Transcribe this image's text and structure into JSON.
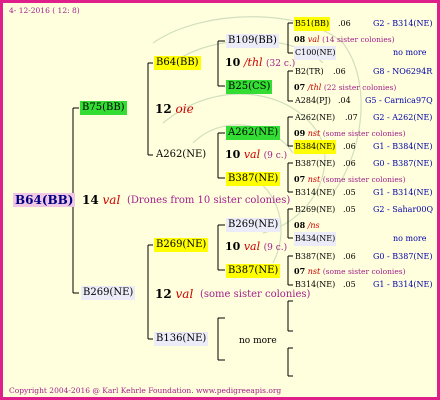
{
  "header": {
    "date": "4- 12-2016 ( 12:  8)"
  },
  "footer": {
    "text": "Copyright 2004-2016 @ Karl Kehrle Foundation.   www.pedigreeapis.org"
  },
  "root": {
    "name": "B64(BB)",
    "num": "14",
    "desc": "val",
    "note": "(Drones from 10 sister colonies)"
  },
  "gen1": {
    "top": {
      "name": "B75(BB)",
      "num": "12",
      "desc": "oie"
    },
    "bottom": {
      "name": "B269(NE)",
      "num": "12",
      "desc": "val",
      "note": "(some sister colonies)"
    }
  },
  "gen2": {
    "b64": {
      "name": "B64(BB)"
    },
    "a262": {
      "name": "A262(NE)"
    },
    "b269": {
      "name": "B269(NE)"
    },
    "b136": {
      "name": "B136(NE)",
      "note": "no more"
    }
  },
  "gen3": {
    "b109": {
      "name": "B109(BB)",
      "num": "10",
      "desc": "/thl",
      "note": "(32 c.)"
    },
    "b25": {
      "name": "B25(CS)"
    },
    "a262b": {
      "name": "A262(NE)",
      "num": "10",
      "desc": "val",
      "note": "(9 c.)"
    },
    "b387a": {
      "name": "B387(NE)"
    },
    "b269b": {
      "name": "B269(NE)",
      "num": "10",
      "desc": "val",
      "note": "(9 c.)"
    },
    "b387b": {
      "name": "B387(NE)"
    }
  },
  "gen4": {
    "g1": {
      "a": {
        "name": "B51(BB)",
        "score": ".06",
        "ref": "G2 - B314(NE)"
      },
      "num": "08",
      "desc": "val",
      "note": "(14 sister colonies)",
      "b": {
        "name": "C100(NE)",
        "ref": "no more"
      }
    },
    "g2": {
      "a": {
        "name": "B2(TR)",
        "score": ".06",
        "ref": "G8 - NO6294R"
      },
      "num": "07",
      "desc": "/thl",
      "note": "(22 sister colonies)",
      "b": {
        "name": "A284(PJ)",
        "score": ".04",
        "ref": "G5 - Carnica97Q"
      }
    },
    "g3": {
      "a": {
        "name": "A262(NE)",
        "score": ".07",
        "ref": "G2 - A262(NE)"
      },
      "num": "09",
      "desc": "nst",
      "note": "(some sister colonies)",
      "b": {
        "name": "B384(NE)",
        "score": ".06",
        "ref": "G1 - B384(NE)"
      }
    },
    "g4": {
      "a": {
        "name": "B387(NE)",
        "score": ".06",
        "ref": "G0 - B387(NE)"
      },
      "num": "07",
      "desc": "nst",
      "note": "(some sister colonies)",
      "b": {
        "name": "B314(NE)",
        "score": ".05",
        "ref": "G1 - B314(NE)"
      }
    },
    "g5": {
      "a": {
        "name": "B269(NE)",
        "score": ".05",
        "ref": "G2 - Sahar00Q"
      },
      "num": "08",
      "desc": "/ns",
      "b": {
        "name": "B434(NE)",
        "ref": "no more"
      }
    },
    "g6": {
      "a": {
        "name": "B387(NE)",
        "score": ".06",
        "ref": "G0 - B387(NE)"
      },
      "num": "07",
      "desc": "nst",
      "note": "(some sister colonies)",
      "b": {
        "name": "B314(NE)",
        "score": ".05",
        "ref": "G1 - B314(NE)"
      }
    }
  },
  "colors": {
    "border": "#e0208a",
    "background": "#ffffdd",
    "yellow": "#ffff00",
    "green": "#33dd33",
    "red": "#cc0000",
    "purple": "#a0208a",
    "blue": "#0000aa"
  }
}
